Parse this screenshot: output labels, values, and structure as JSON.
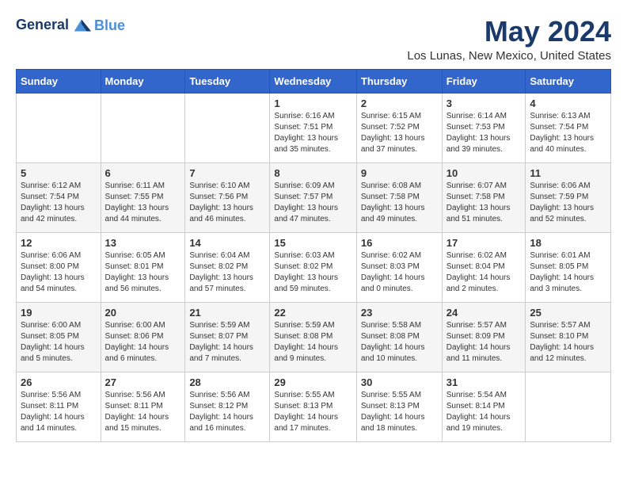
{
  "logo": {
    "line1": "General",
    "line2": "Blue"
  },
  "title": "May 2024",
  "location": "Los Lunas, New Mexico, United States",
  "days_of_week": [
    "Sunday",
    "Monday",
    "Tuesday",
    "Wednesday",
    "Thursday",
    "Friday",
    "Saturday"
  ],
  "weeks": [
    [
      {
        "day": "",
        "info": ""
      },
      {
        "day": "",
        "info": ""
      },
      {
        "day": "",
        "info": ""
      },
      {
        "day": "1",
        "info": "Sunrise: 6:16 AM\nSunset: 7:51 PM\nDaylight: 13 hours\nand 35 minutes."
      },
      {
        "day": "2",
        "info": "Sunrise: 6:15 AM\nSunset: 7:52 PM\nDaylight: 13 hours\nand 37 minutes."
      },
      {
        "day": "3",
        "info": "Sunrise: 6:14 AM\nSunset: 7:53 PM\nDaylight: 13 hours\nand 39 minutes."
      },
      {
        "day": "4",
        "info": "Sunrise: 6:13 AM\nSunset: 7:54 PM\nDaylight: 13 hours\nand 40 minutes."
      }
    ],
    [
      {
        "day": "5",
        "info": "Sunrise: 6:12 AM\nSunset: 7:54 PM\nDaylight: 13 hours\nand 42 minutes."
      },
      {
        "day": "6",
        "info": "Sunrise: 6:11 AM\nSunset: 7:55 PM\nDaylight: 13 hours\nand 44 minutes."
      },
      {
        "day": "7",
        "info": "Sunrise: 6:10 AM\nSunset: 7:56 PM\nDaylight: 13 hours\nand 46 minutes."
      },
      {
        "day": "8",
        "info": "Sunrise: 6:09 AM\nSunset: 7:57 PM\nDaylight: 13 hours\nand 47 minutes."
      },
      {
        "day": "9",
        "info": "Sunrise: 6:08 AM\nSunset: 7:58 PM\nDaylight: 13 hours\nand 49 minutes."
      },
      {
        "day": "10",
        "info": "Sunrise: 6:07 AM\nSunset: 7:58 PM\nDaylight: 13 hours\nand 51 minutes."
      },
      {
        "day": "11",
        "info": "Sunrise: 6:06 AM\nSunset: 7:59 PM\nDaylight: 13 hours\nand 52 minutes."
      }
    ],
    [
      {
        "day": "12",
        "info": "Sunrise: 6:06 AM\nSunset: 8:00 PM\nDaylight: 13 hours\nand 54 minutes."
      },
      {
        "day": "13",
        "info": "Sunrise: 6:05 AM\nSunset: 8:01 PM\nDaylight: 13 hours\nand 56 minutes."
      },
      {
        "day": "14",
        "info": "Sunrise: 6:04 AM\nSunset: 8:02 PM\nDaylight: 13 hours\nand 57 minutes."
      },
      {
        "day": "15",
        "info": "Sunrise: 6:03 AM\nSunset: 8:02 PM\nDaylight: 13 hours\nand 59 minutes."
      },
      {
        "day": "16",
        "info": "Sunrise: 6:02 AM\nSunset: 8:03 PM\nDaylight: 14 hours\nand 0 minutes."
      },
      {
        "day": "17",
        "info": "Sunrise: 6:02 AM\nSunset: 8:04 PM\nDaylight: 14 hours\nand 2 minutes."
      },
      {
        "day": "18",
        "info": "Sunrise: 6:01 AM\nSunset: 8:05 PM\nDaylight: 14 hours\nand 3 minutes."
      }
    ],
    [
      {
        "day": "19",
        "info": "Sunrise: 6:00 AM\nSunset: 8:05 PM\nDaylight: 14 hours\nand 5 minutes."
      },
      {
        "day": "20",
        "info": "Sunrise: 6:00 AM\nSunset: 8:06 PM\nDaylight: 14 hours\nand 6 minutes."
      },
      {
        "day": "21",
        "info": "Sunrise: 5:59 AM\nSunset: 8:07 PM\nDaylight: 14 hours\nand 7 minutes."
      },
      {
        "day": "22",
        "info": "Sunrise: 5:59 AM\nSunset: 8:08 PM\nDaylight: 14 hours\nand 9 minutes."
      },
      {
        "day": "23",
        "info": "Sunrise: 5:58 AM\nSunset: 8:08 PM\nDaylight: 14 hours\nand 10 minutes."
      },
      {
        "day": "24",
        "info": "Sunrise: 5:57 AM\nSunset: 8:09 PM\nDaylight: 14 hours\nand 11 minutes."
      },
      {
        "day": "25",
        "info": "Sunrise: 5:57 AM\nSunset: 8:10 PM\nDaylight: 14 hours\nand 12 minutes."
      }
    ],
    [
      {
        "day": "26",
        "info": "Sunrise: 5:56 AM\nSunset: 8:11 PM\nDaylight: 14 hours\nand 14 minutes."
      },
      {
        "day": "27",
        "info": "Sunrise: 5:56 AM\nSunset: 8:11 PM\nDaylight: 14 hours\nand 15 minutes."
      },
      {
        "day": "28",
        "info": "Sunrise: 5:56 AM\nSunset: 8:12 PM\nDaylight: 14 hours\nand 16 minutes."
      },
      {
        "day": "29",
        "info": "Sunrise: 5:55 AM\nSunset: 8:13 PM\nDaylight: 14 hours\nand 17 minutes."
      },
      {
        "day": "30",
        "info": "Sunrise: 5:55 AM\nSunset: 8:13 PM\nDaylight: 14 hours\nand 18 minutes."
      },
      {
        "day": "31",
        "info": "Sunrise: 5:54 AM\nSunset: 8:14 PM\nDaylight: 14 hours\nand 19 minutes."
      },
      {
        "day": "",
        "info": ""
      }
    ]
  ]
}
